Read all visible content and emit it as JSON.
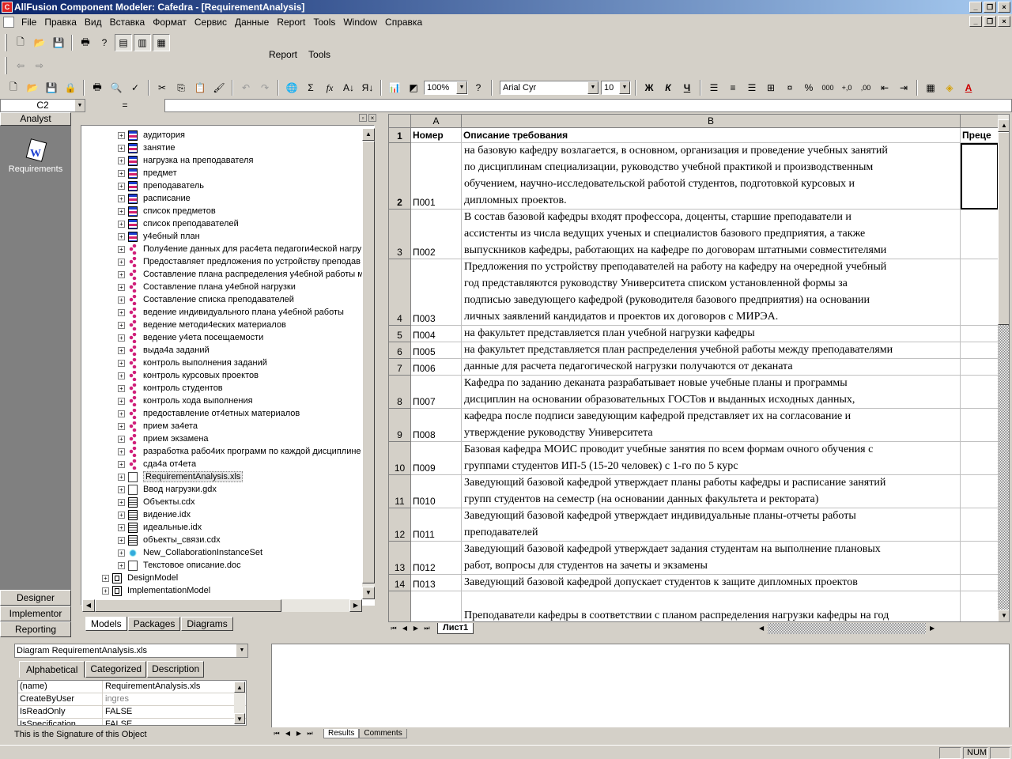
{
  "title": "AllFusion Component Modeler: Cafedra - [RequirementAnalysis]",
  "menu": [
    "File",
    "Правка",
    "Вид",
    "Вставка",
    "Формат",
    "Сервис",
    "Данные",
    "Report",
    "Tools",
    "Window",
    "Справка"
  ],
  "report_menu": [
    "Report",
    "Tools"
  ],
  "zoom": "100%",
  "font_name": "Arial Cyr",
  "font_size": "10",
  "bold": "Ж",
  "italic": "К",
  "underline": "Ч",
  "namebox": "C2",
  "formula_eq": "=",
  "analyst": {
    "header": "Analyst",
    "item": "Requirements"
  },
  "left_buttons": [
    "Designer",
    "Implementor",
    "Reporting"
  ],
  "tree": [
    {
      "t": "ent",
      "label": "аудитория"
    },
    {
      "t": "ent",
      "label": "занятие"
    },
    {
      "t": "ent",
      "label": "нагрузка на преподавателя"
    },
    {
      "t": "ent",
      "label": "предмет"
    },
    {
      "t": "ent",
      "label": "преподаватель"
    },
    {
      "t": "ent",
      "label": "расписание"
    },
    {
      "t": "ent",
      "label": "список предметов"
    },
    {
      "t": "ent",
      "label": "список преподавателей"
    },
    {
      "t": "ent",
      "label": "у4ебный план"
    },
    {
      "t": "proc",
      "label": "Полу4ение данных для рас4ета педагоги4еской нагру"
    },
    {
      "t": "proc",
      "label": "Предоставляет предложения по устройству преподав"
    },
    {
      "t": "proc",
      "label": "Составление плана распределения у4ебной работы м"
    },
    {
      "t": "proc",
      "label": "Составление плана у4ебной нагрузки"
    },
    {
      "t": "proc",
      "label": "Составление списка преподавателей"
    },
    {
      "t": "proc",
      "label": "ведение индивидуального плана у4ебной работы"
    },
    {
      "t": "proc",
      "label": "ведение методи4еских материалов"
    },
    {
      "t": "proc",
      "label": "ведение у4ета посещаемости"
    },
    {
      "t": "proc",
      "label": "выда4а заданий"
    },
    {
      "t": "proc",
      "label": "контроль выполнения заданий"
    },
    {
      "t": "proc",
      "label": "контроль курсовых проектов"
    },
    {
      "t": "proc",
      "label": "контроль студентов"
    },
    {
      "t": "proc",
      "label": "контроль хода выполнения"
    },
    {
      "t": "proc",
      "label": "предоставление от4етных материалов"
    },
    {
      "t": "proc",
      "label": "прием за4ета"
    },
    {
      "t": "proc",
      "label": "прием экзамена"
    },
    {
      "t": "proc",
      "label": "разработка рабо4их программ по каждой дисциплине"
    },
    {
      "t": "proc",
      "label": "сда4а от4ета"
    },
    {
      "t": "doc",
      "label": "RequirementAnalysis.xls",
      "selected": true
    },
    {
      "t": "doc",
      "label": "Ввод нагрузки.gdx"
    },
    {
      "t": "cdx",
      "label": "Объекты.cdx"
    },
    {
      "t": "cdx",
      "label": "видение.idx"
    },
    {
      "t": "cdx",
      "label": "идеальные.idx"
    },
    {
      "t": "cdx",
      "label": "объекты_связи.cdx"
    },
    {
      "t": "col",
      "label": "New_CollaborationInstanceSet"
    },
    {
      "t": "doc",
      "label": "Текстовое описание.doc"
    },
    {
      "t": "dm",
      "label": "DesignModel",
      "top": true
    },
    {
      "t": "dm",
      "label": "ImplementationModel",
      "top": true
    }
  ],
  "tree_tabs": [
    "Models",
    "Packages",
    "Diagrams"
  ],
  "sheet": {
    "col_headers": [
      "A",
      "B"
    ],
    "header_row": {
      "num": "1",
      "a": "Номер",
      "b": "Описание требования",
      "c": "Преце"
    },
    "rows": [
      {
        "num": "2",
        "a": "П001",
        "lines": [
          "на базовую кафедру возлагается, в основном, организация и проведение учебных занятий",
          "по дисциплинам специализации, руководство учебной практикой и производственным",
          "обучением, научно-исследовательской работой студентов, подготовкой курсовых и",
          "дипломных проектов."
        ]
      },
      {
        "num": "3",
        "a": "П002",
        "lines": [
          "В состав базовой кафедры входят профессора, доценты, старшие преподаватели и",
          "ассистенты из числа ведущих ученых и специалистов базового предприятия, а также",
          "выпускников кафедры, работающих на кафедре по договорам штатными совместителями"
        ]
      },
      {
        "num": "4",
        "a": "П003",
        "lines": [
          "Предложения по устройству преподавателей на работу на кафедру на очередной учебный",
          "год представляются руководству Университета списком установленной формы за",
          "подписью заведующего кафедрой (руководителя базового предприятия) на основании",
          "личных заявлений кандидатов и проектов их договоров с МИРЭА."
        ]
      },
      {
        "num": "5",
        "a": "П004",
        "lines": [
          "на факультет представляется план учебной нагрузки кафедры"
        ]
      },
      {
        "num": "6",
        "a": "П005",
        "lines": [
          "на факультет представляется план распределения учебной работы между преподавателями"
        ]
      },
      {
        "num": "7",
        "a": "П006",
        "lines": [
          "данные для расчета педагогической нагрузки получаются от деканата"
        ]
      },
      {
        "num": "8",
        "a": "П007",
        "lines": [
          "Кафедра по заданию деканата разрабатывает новые учебные планы и программы",
          "дисциплин на основании образовательных ГОСТов и выданных исходных данных,"
        ]
      },
      {
        "num": "9",
        "a": "П008",
        "lines": [
          "кафедра после подписи заведующим кафедрой представляет их на согласование и",
          "утверждение руководству Университета"
        ]
      },
      {
        "num": "10",
        "a": "П009",
        "lines": [
          "Базовая кафедра МОИС проводит учебные занятия по всем формам очного обучения с",
          "группами студентов ИП-5 (15-20 человек) с 1-го по 5 курс"
        ]
      },
      {
        "num": "11",
        "a": "П010",
        "lines": [
          "Заведующий базовой кафедрой утверждает планы работы кафедры и расписание занятий",
          "групп студентов на семестр (на основании данных факультета и ректората)"
        ]
      },
      {
        "num": "12",
        "a": "П011",
        "lines": [
          "Заведующий базовой кафедрой утверждает индивидуальные планы-отчеты работы",
          "преподавателей"
        ]
      },
      {
        "num": "13",
        "a": "П012",
        "lines": [
          "Заведующий базовой кафедрой утверждает задания студентам на выполнение плановых",
          "работ, вопросы для студентов на зачеты и экзамены"
        ]
      },
      {
        "num": "14",
        "a": "П013",
        "lines": [
          "Заведующий базовой кафедрой допускает студентов к защите дипломных проектов"
        ]
      },
      {
        "num": "",
        "a": "",
        "lines": [
          "",
          "Преподаватели кафедры в соответствии с планом распределения нагрузки кафедры на год"
        ]
      }
    ],
    "sheet_tab": "Лист1"
  },
  "props": {
    "combo": "Diagram RequirementAnalysis.xls",
    "tabs": [
      "Alphabetical",
      "Categorized",
      "Description"
    ],
    "rows": [
      {
        "k": "(name)",
        "v": "RequirementAnalysis.xls"
      },
      {
        "k": "CreateByUser",
        "v": "ingres",
        "gray": true
      },
      {
        "k": "IsReadOnly",
        "v": "FALSE"
      },
      {
        "k": "IsSpecification",
        "v": "FALSE"
      }
    ],
    "signature": "This is the Signature of this Object"
  },
  "output_tabs": [
    "Results",
    "Comments"
  ],
  "status": {
    "num": "NUM"
  }
}
